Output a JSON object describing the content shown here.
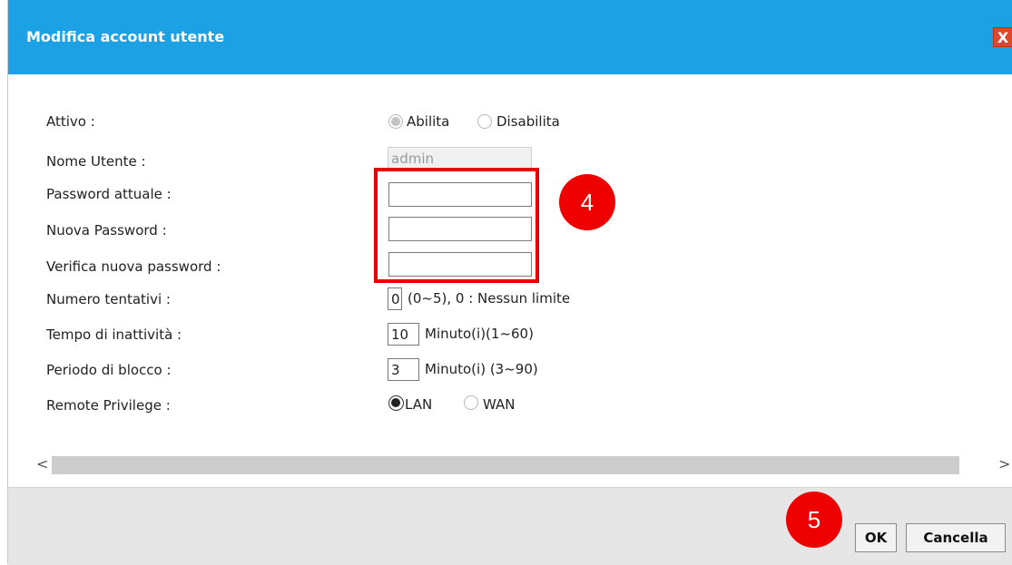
{
  "dialog": {
    "title": "Modifica account utente",
    "close_label": "X"
  },
  "form": {
    "active_label": "Attivo :",
    "active_enable": "Abilita",
    "active_disable": "Disabilita",
    "username_label": "Nome Utente :",
    "username_value": "admin",
    "current_password_label": "Password attuale :",
    "new_password_label": "Nuova Password :",
    "verify_password_label": "Verifica nuova password :",
    "attempts_label": "Numero tentativi :",
    "attempts_value": "0",
    "attempts_hint": "(0~5), 0 : Nessun limite",
    "idle_label": "Tempo di inattività :",
    "idle_value": "10",
    "idle_hint": "Minuto(i)(1~60)",
    "lockout_label": "Periodo di blocco :",
    "lockout_value": "3",
    "lockout_hint": "Minuto(i) (3~90)",
    "remote_label": "Remote Privilege :",
    "remote_lan": "LAN",
    "remote_wan": "WAN"
  },
  "annotations": {
    "step4": "4",
    "step5": "5"
  },
  "scrollbar": {
    "left_arrow": "<",
    "right_arrow": ">"
  },
  "footer": {
    "ok_label": "OK",
    "cancel_label": "Cancella"
  },
  "colors": {
    "titlebar": "#1ca1e5",
    "highlight": "#e80000",
    "badge": "#ee0000"
  }
}
